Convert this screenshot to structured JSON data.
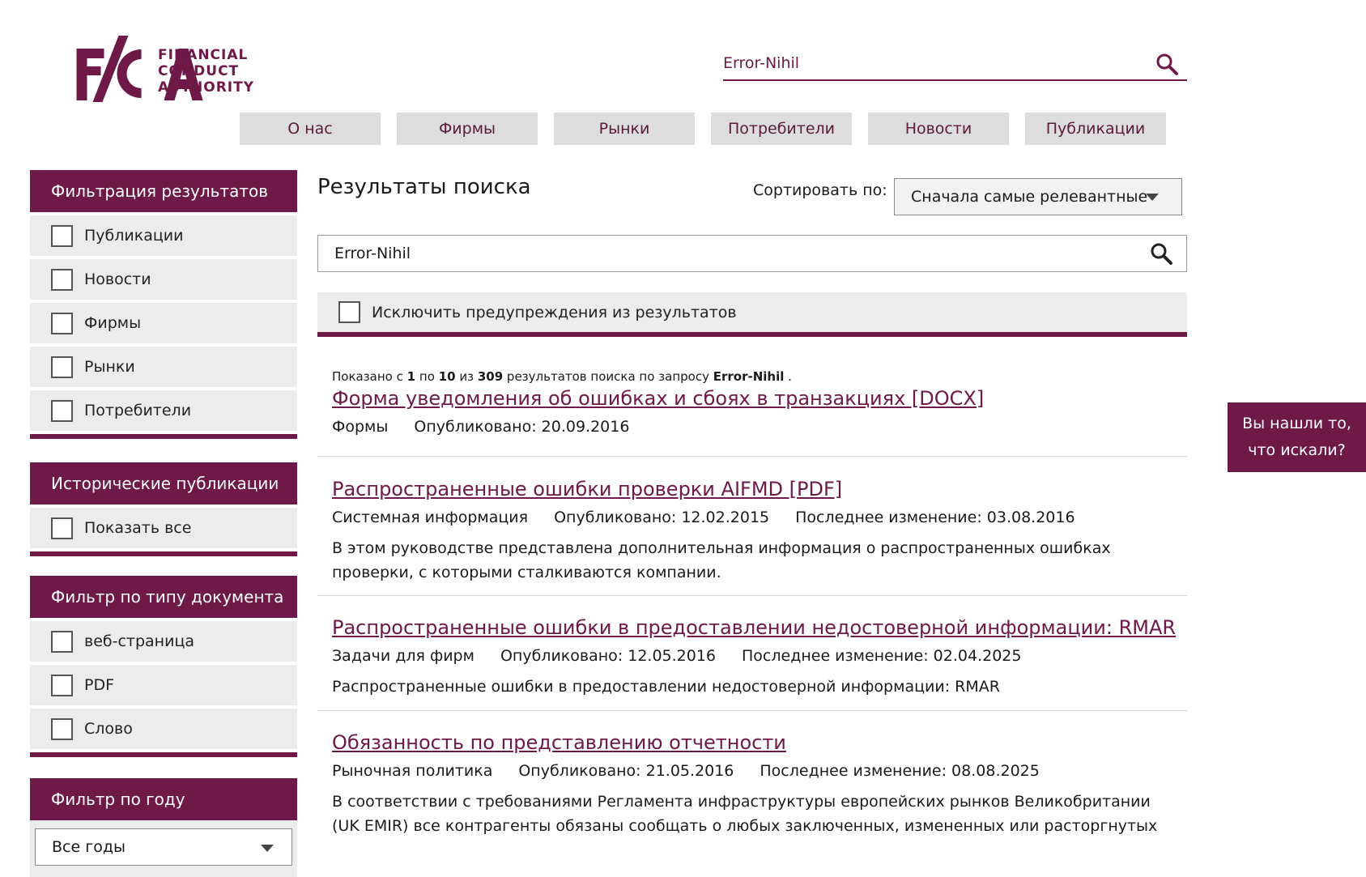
{
  "logo": {
    "letters": "FCA",
    "lines": [
      "FINANCIAL",
      "CONDUCT",
      "AUTHORITY"
    ]
  },
  "header": {
    "search_value": "Error-Nihil"
  },
  "nav": [
    "О нас",
    "Фирмы",
    "Рынки",
    "Потребители",
    "Новости",
    "Публикации"
  ],
  "sidebar": {
    "filter_results": {
      "title": "Фильтрация результатов",
      "items": [
        "Публикации",
        "Новости",
        "Фирмы",
        "Рынки",
        "Потребители"
      ]
    },
    "historical": {
      "title": "Исторические публикации",
      "items": [
        "Показать все"
      ]
    },
    "doc_type": {
      "title": "Фильтр по типу документа",
      "items": [
        "веб-страница",
        "PDF",
        "Слово"
      ]
    },
    "year": {
      "title": "Фильтр по году",
      "selected": "Все годы"
    }
  },
  "main": {
    "title": "Результаты поиска",
    "sort_label": "Сортировать по:",
    "sort_selected": "Сначала самые релевантные",
    "search_value": "Error-Nihil",
    "exclude_label": "Исключить предупреждения из результатов",
    "summary": {
      "prefix": "Показано с",
      "from": "1",
      "to_word": "по",
      "to": "10",
      "of_word": "из",
      "total": "309",
      "middle": "результатов поиска по запросу",
      "query": "Error-Nihil",
      "end": "."
    },
    "results": [
      {
        "title": "Форма уведомления об ошибках и сбоях в транзакциях [DOCX]",
        "type": "Формы",
        "published": "Опубликовано: 20.09.2016",
        "modified": "",
        "description": ""
      },
      {
        "title": "Распространенные ошибки проверки AIFMD [PDF]",
        "type": "Системная информация",
        "published": "Опубликовано: 12.02.2015",
        "modified": "Последнее изменение: 03.08.2016",
        "description": "В этом руководстве представлена дополнительная информация о распространенных ошибках проверки, с которыми сталкиваются компании."
      },
      {
        "title": "Распространенные ошибки в предоставлении недостоверной информации: RMAR",
        "type": "Задачи для фирм",
        "published": "Опубликовано: 12.05.2016",
        "modified": "Последнее изменение: 02.04.2025",
        "description": "Распространенные ошибки в предоставлении недостоверной информации: RMAR"
      },
      {
        "title": "Обязанность по представлению отчетности",
        "type": "Рыночная политика",
        "published": "Опубликовано: 21.05.2016",
        "modified": "Последнее изменение: 08.08.2025",
        "description": "В соответствии с требованиями Регламента инфраструктуры европейских рынков Великобритании (UK EMIR) все контрагенты обязаны сообщать о любых заключенных, измененных или расторгнутых"
      }
    ]
  },
  "feedback": {
    "line1": "Вы нашли то,",
    "line2": "что искали?"
  },
  "colors": {
    "brand": "#6e1948",
    "nav_bg": "#dddddd",
    "panel_bg": "#ececec"
  }
}
